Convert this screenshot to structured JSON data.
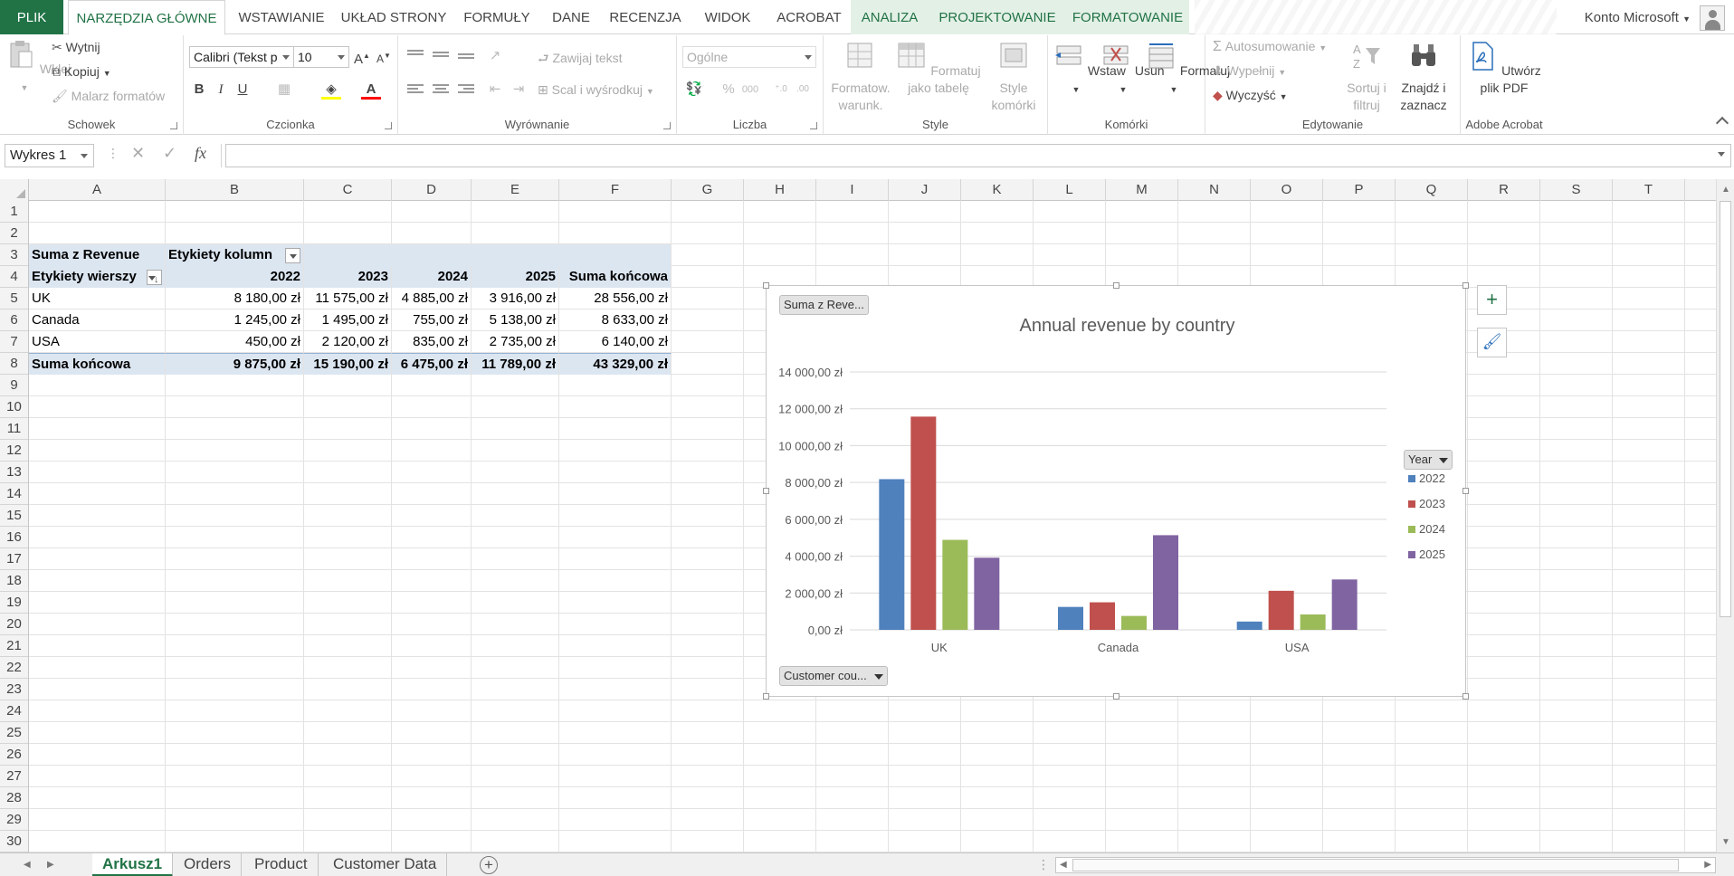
{
  "tabs": {
    "file": "PLIK",
    "home": "NARZĘDZIA GŁÓWNE",
    "insert": "WSTAWIANIE",
    "layout": "UKŁAD STRONY",
    "formulas": "FORMUŁY",
    "data": "DANE",
    "review": "RECENZJA",
    "view": "WIDOK",
    "acrobat": "ACROBAT",
    "analyze": "ANALIZA",
    "design": "PROJEKTOWANIE",
    "format": "FORMATOWANIE"
  },
  "account": "Konto Microsoft",
  "ribbon": {
    "clipboard": {
      "label": "Schowek",
      "paste": "Wklej",
      "cut": "Wytnij",
      "copy": "Kopiuj",
      "painter": "Malarz formatów"
    },
    "font": {
      "label": "Czcionka",
      "name": "Calibri (Tekst p",
      "size": "10",
      "bold": "B",
      "italic": "I",
      "underline": "U"
    },
    "alignment": {
      "label": "Wyrównanie",
      "wrap": "Zawijaj tekst",
      "merge": "Scal i wyśrodkuj"
    },
    "number": {
      "label": "Liczba",
      "format": "Ogólne",
      "percent": "%",
      "thousands": "000"
    },
    "styles": {
      "label": "Style",
      "cond": "Formatow. warunk.",
      "table": "Formatuj jako tabelę",
      "cell": "Style komórki"
    },
    "cells": {
      "label": "Komórki",
      "insert": "Wstaw",
      "delete": "Usuń",
      "format": "Formatuj"
    },
    "editing": {
      "label": "Edytowanie",
      "autosum": "Autosumowanie",
      "fill": "Wypełnij",
      "clear": "Wyczyść",
      "sort": "Sortuj i filtruj",
      "find": "Znajdź i zaznacz"
    },
    "acrobat": {
      "label": "Adobe Acrobat",
      "create": "Utwórz plik PDF"
    }
  },
  "namebox": "Wykres 1",
  "fx": "fx",
  "columns": [
    "A",
    "B",
    "C",
    "D",
    "E",
    "F",
    "G",
    "H",
    "I",
    "J",
    "K",
    "L",
    "M",
    "N",
    "O",
    "P",
    "Q",
    "R",
    "S",
    "T"
  ],
  "rows": [
    "1",
    "2",
    "3",
    "4",
    "5",
    "6",
    "7",
    "8",
    "9",
    "10",
    "11",
    "12",
    "13",
    "14",
    "15",
    "16",
    "17",
    "18",
    "19",
    "20",
    "21",
    "22",
    "23",
    "24",
    "25",
    "26",
    "27",
    "28",
    "29",
    "30"
  ],
  "pivot": {
    "value_field": "Suma z Revenue",
    "col_labels": "Etykiety kolumn",
    "row_labels": "Etykiety wierszy",
    "years": [
      "2022",
      "2023",
      "2024",
      "2025"
    ],
    "grand_total_label": "Suma końcowa",
    "data": [
      [
        "UK",
        "8 180,00 zł",
        "11 575,00 zł",
        "4 885,00 zł",
        "3 916,00 zł",
        "28 556,00 zł"
      ],
      [
        "Canada",
        "1 245,00 zł",
        "1 495,00 zł",
        "755,00 zł",
        "5 138,00 zł",
        "8 633,00 zł"
      ],
      [
        "USA",
        "450,00 zł",
        "2 120,00 zł",
        "835,00 zł",
        "2 735,00 zł",
        "6 140,00 zł"
      ]
    ],
    "totals": [
      "Suma końcowa",
      "9 875,00 zł",
      "15 190,00 zł",
      "6 475,00 zł",
      "11 789,00 zł",
      "43 329,00 zł"
    ]
  },
  "chart_buttons": {
    "value": "Suma z Reve...",
    "legend": "Year",
    "axis": "Customer cou..."
  },
  "chart_data": {
    "type": "bar",
    "title": "Annual revenue by country",
    "categories": [
      "UK",
      "Canada",
      "USA"
    ],
    "series": [
      {
        "name": "2022",
        "values": [
          8180,
          1245,
          450
        ],
        "color": "#4f81bd"
      },
      {
        "name": "2023",
        "values": [
          11575,
          1495,
          2120
        ],
        "color": "#c0504d"
      },
      {
        "name": "2024",
        "values": [
          4885,
          755,
          835
        ],
        "color": "#9bbb59"
      },
      {
        "name": "2025",
        "values": [
          3916,
          5138,
          2735
        ],
        "color": "#8064a2"
      }
    ],
    "ylim": [
      0,
      14000
    ],
    "yticks": [
      "0,00 zł",
      "2 000,00 zł",
      "4 000,00 zł",
      "6 000,00 zł",
      "8 000,00 zł",
      "10 000,00 zł",
      "12 000,00 zł",
      "14 000,00 zł"
    ],
    "grid": true,
    "legend": "right"
  },
  "sheets": [
    "Arkusz1",
    "Orders",
    "Product",
    "Customer Data"
  ]
}
